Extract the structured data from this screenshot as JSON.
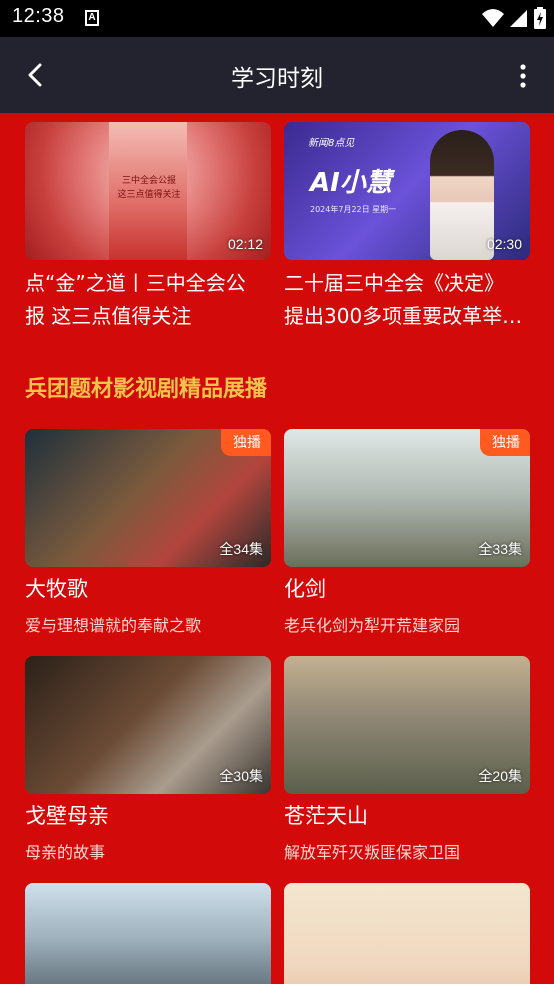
{
  "status_bar": {
    "time": "12:38",
    "notif_letter": "A"
  },
  "nav": {
    "title": "学习时刻"
  },
  "top_videos": [
    {
      "title_line1": "点“金”之道丨三中全会公",
      "title_line2": "报 这三点值得关注",
      "duration": "02:12",
      "thumb_text1": "三中全会公报",
      "thumb_text2": "这三点值得关注"
    },
    {
      "title_line1": "二十届三中全会《决定》",
      "title_line2": "提出300多项重要改革举…",
      "duration": "02:30",
      "thumb_text": "AI小慧",
      "thumb_date": "2024年7月22日 星期一",
      "thumb_brand": "新闻8点见"
    }
  ],
  "section": {
    "heading": "兵团题材影视剧精品展播"
  },
  "series": [
    {
      "title": "大牧歌",
      "subtitle": "爱与理想谱就的奉献之歌",
      "badge": "独播",
      "episodes": "全34集"
    },
    {
      "title": "化剑",
      "subtitle": "老兵化剑为犁开荒建家园",
      "badge": "独播",
      "episodes": "全33集"
    },
    {
      "title": "戈壁母亲",
      "subtitle": "母亲的故事",
      "badge": "",
      "episodes": "全30集"
    },
    {
      "title": "苍茫天山",
      "subtitle": "解放军歼灭叛匪保家卫国",
      "badge": "",
      "episodes": "全20集"
    }
  ],
  "colors": {
    "page_bg": "#d20a0a",
    "nav_bg": "#232330",
    "heading": "#f2c24a",
    "badge": "#ff5a1f"
  }
}
